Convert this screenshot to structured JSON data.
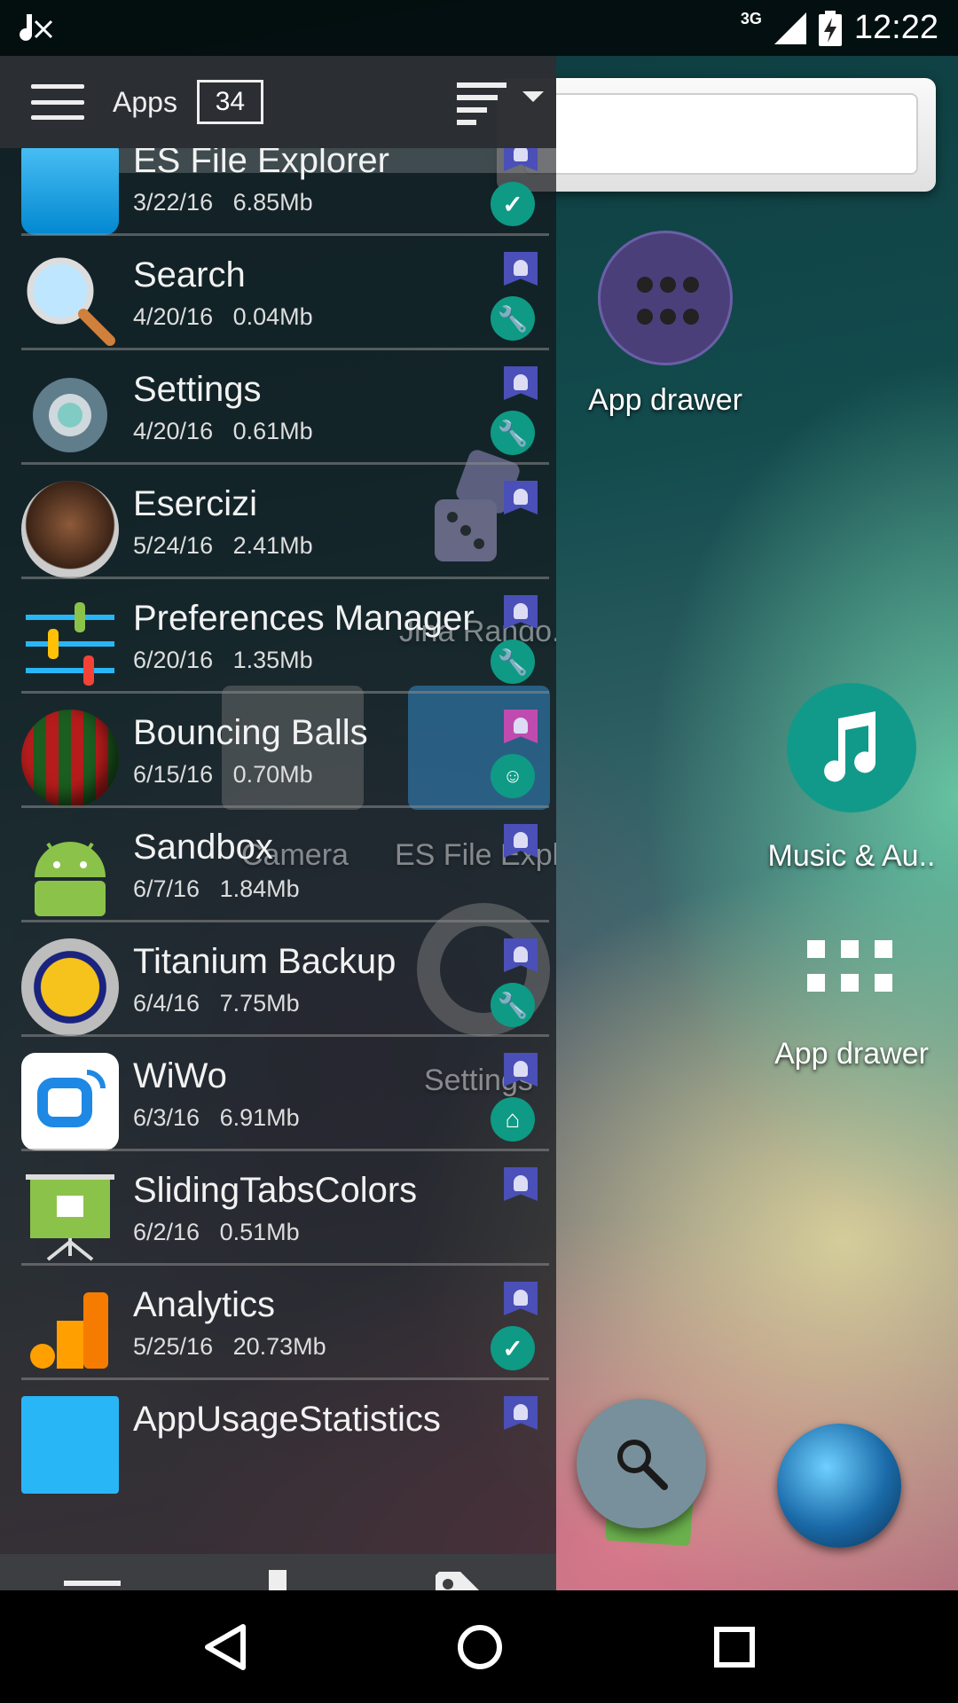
{
  "status_bar": {
    "network": "3G",
    "time": "12:22"
  },
  "drawer": {
    "header": {
      "title": "Apps",
      "count": "34"
    },
    "apps": [
      {
        "name": "ES File Explorer",
        "date": "3/22/16",
        "size": "6.85Mb",
        "status_icon": "check-icon",
        "icon": "es-file-explorer-icon"
      },
      {
        "name": "Search",
        "date": "4/20/16",
        "size": "0.04Mb",
        "status_icon": "wrench-icon",
        "icon": "magnifier-icon"
      },
      {
        "name": "Settings",
        "date": "4/20/16",
        "size": "0.61Mb",
        "status_icon": "wrench-icon",
        "icon": "gear-icon"
      },
      {
        "name": "Esercizi",
        "date": "5/24/16",
        "size": "2.41Mb",
        "status_icon": "",
        "icon": "child-photo-icon"
      },
      {
        "name": "Preferences Manager",
        "date": "6/20/16",
        "size": "1.35Mb",
        "status_icon": "wrench-icon",
        "icon": "sliders-icon"
      },
      {
        "name": "Bouncing Balls",
        "date": "6/15/16",
        "size": "0.70Mb",
        "status_icon": "android-face-icon",
        "icon": "striped-ball-icon"
      },
      {
        "name": "Sandbox",
        "date": "6/7/16",
        "size": "1.84Mb",
        "status_icon": "",
        "icon": "android-robot-icon"
      },
      {
        "name": "Titanium Backup",
        "date": "6/4/16",
        "size": "7.75Mb",
        "status_icon": "wrench-icon",
        "icon": "titanium-icon"
      },
      {
        "name": "WiWo",
        "date": "6/3/16",
        "size": "6.91Mb",
        "status_icon": "home-icon",
        "icon": "wiwo-icon"
      },
      {
        "name": "SlidingTabsColors",
        "date": "6/2/16",
        "size": "0.51Mb",
        "status_icon": "",
        "icon": "presentation-board-icon"
      },
      {
        "name": "Analytics",
        "date": "5/25/16",
        "size": "20.73Mb",
        "status_icon": "check-icon",
        "icon": "analytics-icon"
      },
      {
        "name": "AppUsageStatistics",
        "date": "",
        "size": "",
        "status_icon": "",
        "icon": "sliders-blue-icon"
      }
    ]
  },
  "home_screen": {
    "app_drawer_top": "App drawer",
    "music": "Music & Au..",
    "app_drawer_right": "App drawer",
    "ghost_dice": "Jina Rando..",
    "ghost_camera": "Camera",
    "ghost_es": "ES File Expl..",
    "ghost_settings": "Settings"
  },
  "colors": {
    "accent_teal": "#0e9a84",
    "badge_indigo": "#4b4fb8",
    "drawer_header": "#2d2f34",
    "fab": "#78909c"
  }
}
